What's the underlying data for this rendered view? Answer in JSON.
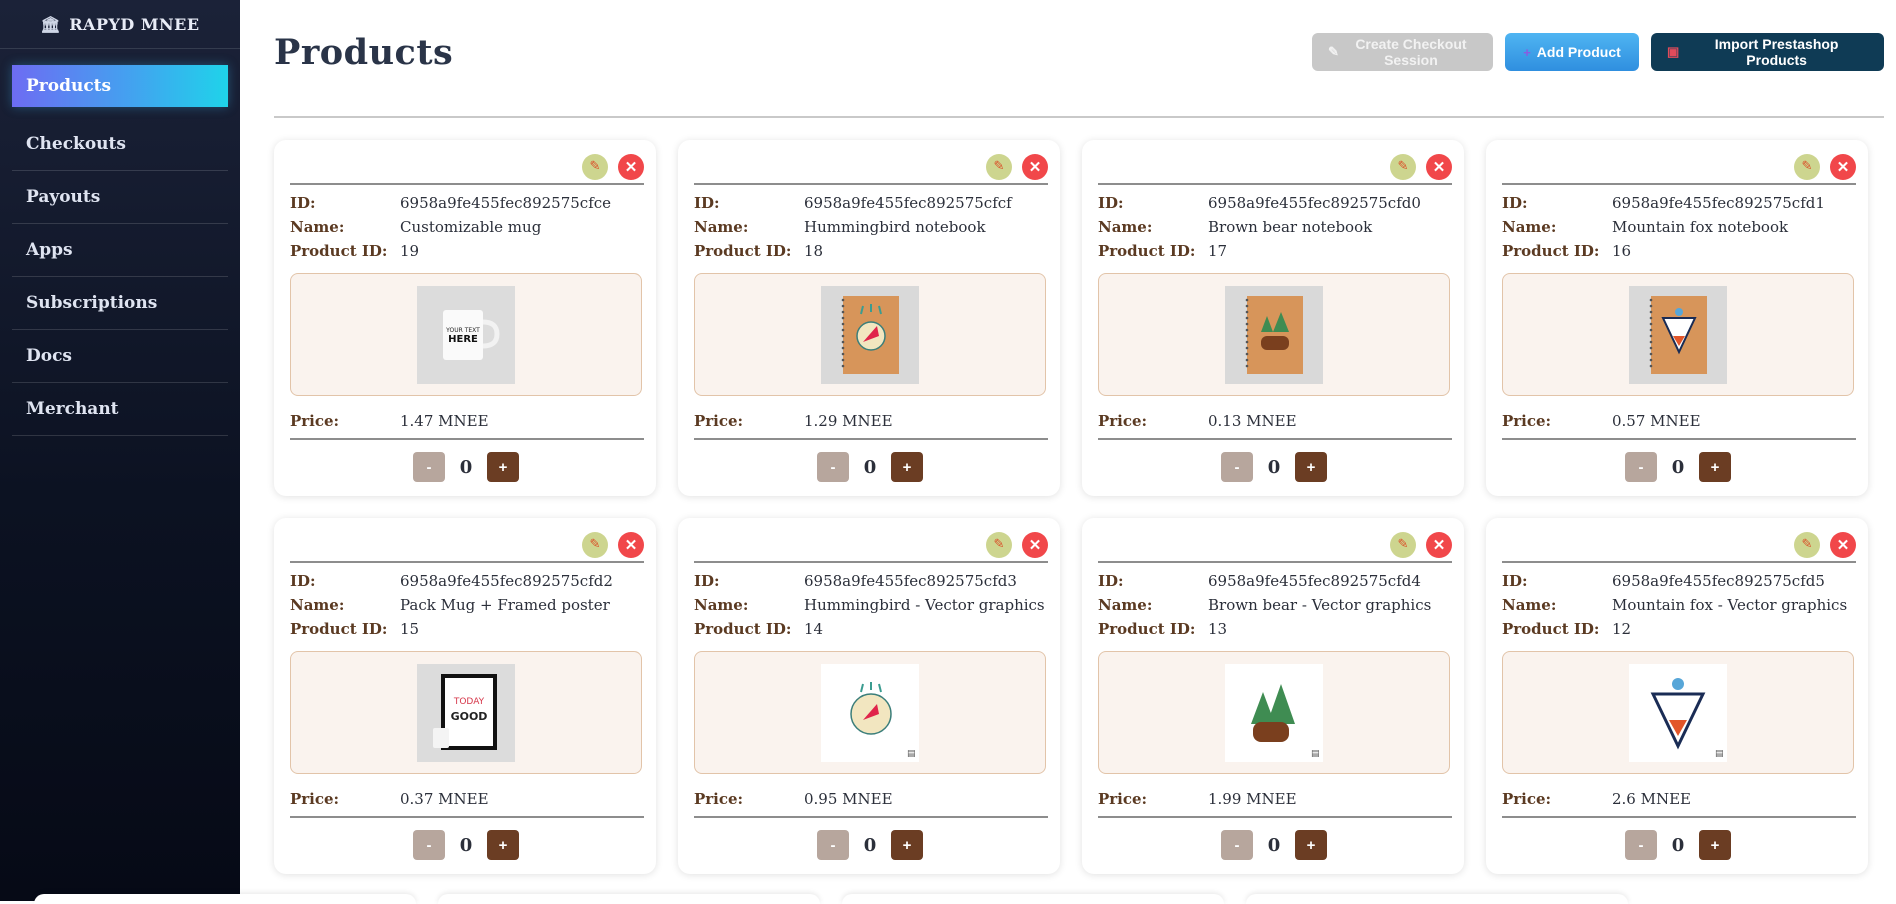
{
  "brand": {
    "name": "RAPYD MNEE",
    "icon": "bank-icon"
  },
  "nav": [
    {
      "label": "Products",
      "active": true
    },
    {
      "label": "Checkouts"
    },
    {
      "label": "Payouts"
    },
    {
      "label": "Apps"
    },
    {
      "label": "Subscriptions"
    },
    {
      "label": "Docs"
    },
    {
      "label": "Merchant"
    }
  ],
  "header": {
    "title": "Products",
    "checkout_label": "Create Checkout Session",
    "add_label": "Add Product",
    "import_label": "Import Prestashop Products"
  },
  "labels": {
    "id": "ID:",
    "name": "Name:",
    "product_id": "Product ID:",
    "price": "Price:"
  },
  "colors": {
    "accent": "#2f8fdf",
    "import": "#0f3b55",
    "delete": "#f1474a",
    "edit": "#cdd58f",
    "plus": "#6b3d23",
    "minus": "#b7a69d"
  },
  "products": [
    {
      "id": "6958a9fe455fec892575cfce",
      "name": "Customizable mug",
      "product_id": "19",
      "price": "1.47 MNEE",
      "qty": "0",
      "image": "mug"
    },
    {
      "id": "6958a9fe455fec892575cfcf",
      "name": "Hummingbird notebook",
      "product_id": "18",
      "price": "1.29 MNEE",
      "qty": "0",
      "image": "notebook-hummingbird"
    },
    {
      "id": "6958a9fe455fec892575cfd0",
      "name": "Brown bear notebook",
      "product_id": "17",
      "price": "0.13 MNEE",
      "qty": "0",
      "image": "notebook-bear"
    },
    {
      "id": "6958a9fe455fec892575cfd1",
      "name": "Mountain fox notebook",
      "product_id": "16",
      "price": "0.57 MNEE",
      "qty": "0",
      "image": "notebook-fox"
    },
    {
      "id": "6958a9fe455fec892575cfd2",
      "name": "Pack Mug + Framed poster",
      "product_id": "15",
      "price": "0.37 MNEE",
      "qty": "0",
      "image": "poster"
    },
    {
      "id": "6958a9fe455fec892575cfd3",
      "name": "Hummingbird - Vector graphics",
      "product_id": "14",
      "price": "0.95 MNEE",
      "qty": "0",
      "image": "vector-hummingbird"
    },
    {
      "id": "6958a9fe455fec892575cfd4",
      "name": "Brown bear - Vector graphics",
      "product_id": "13",
      "price": "1.99 MNEE",
      "qty": "0",
      "image": "vector-bear"
    },
    {
      "id": "6958a9fe455fec892575cfd5",
      "name": "Mountain fox - Vector graphics",
      "product_id": "12",
      "price": "2.6 MNEE",
      "qty": "0",
      "image": "vector-fox"
    }
  ],
  "qty_controls": {
    "minus": "-",
    "plus": "+"
  }
}
